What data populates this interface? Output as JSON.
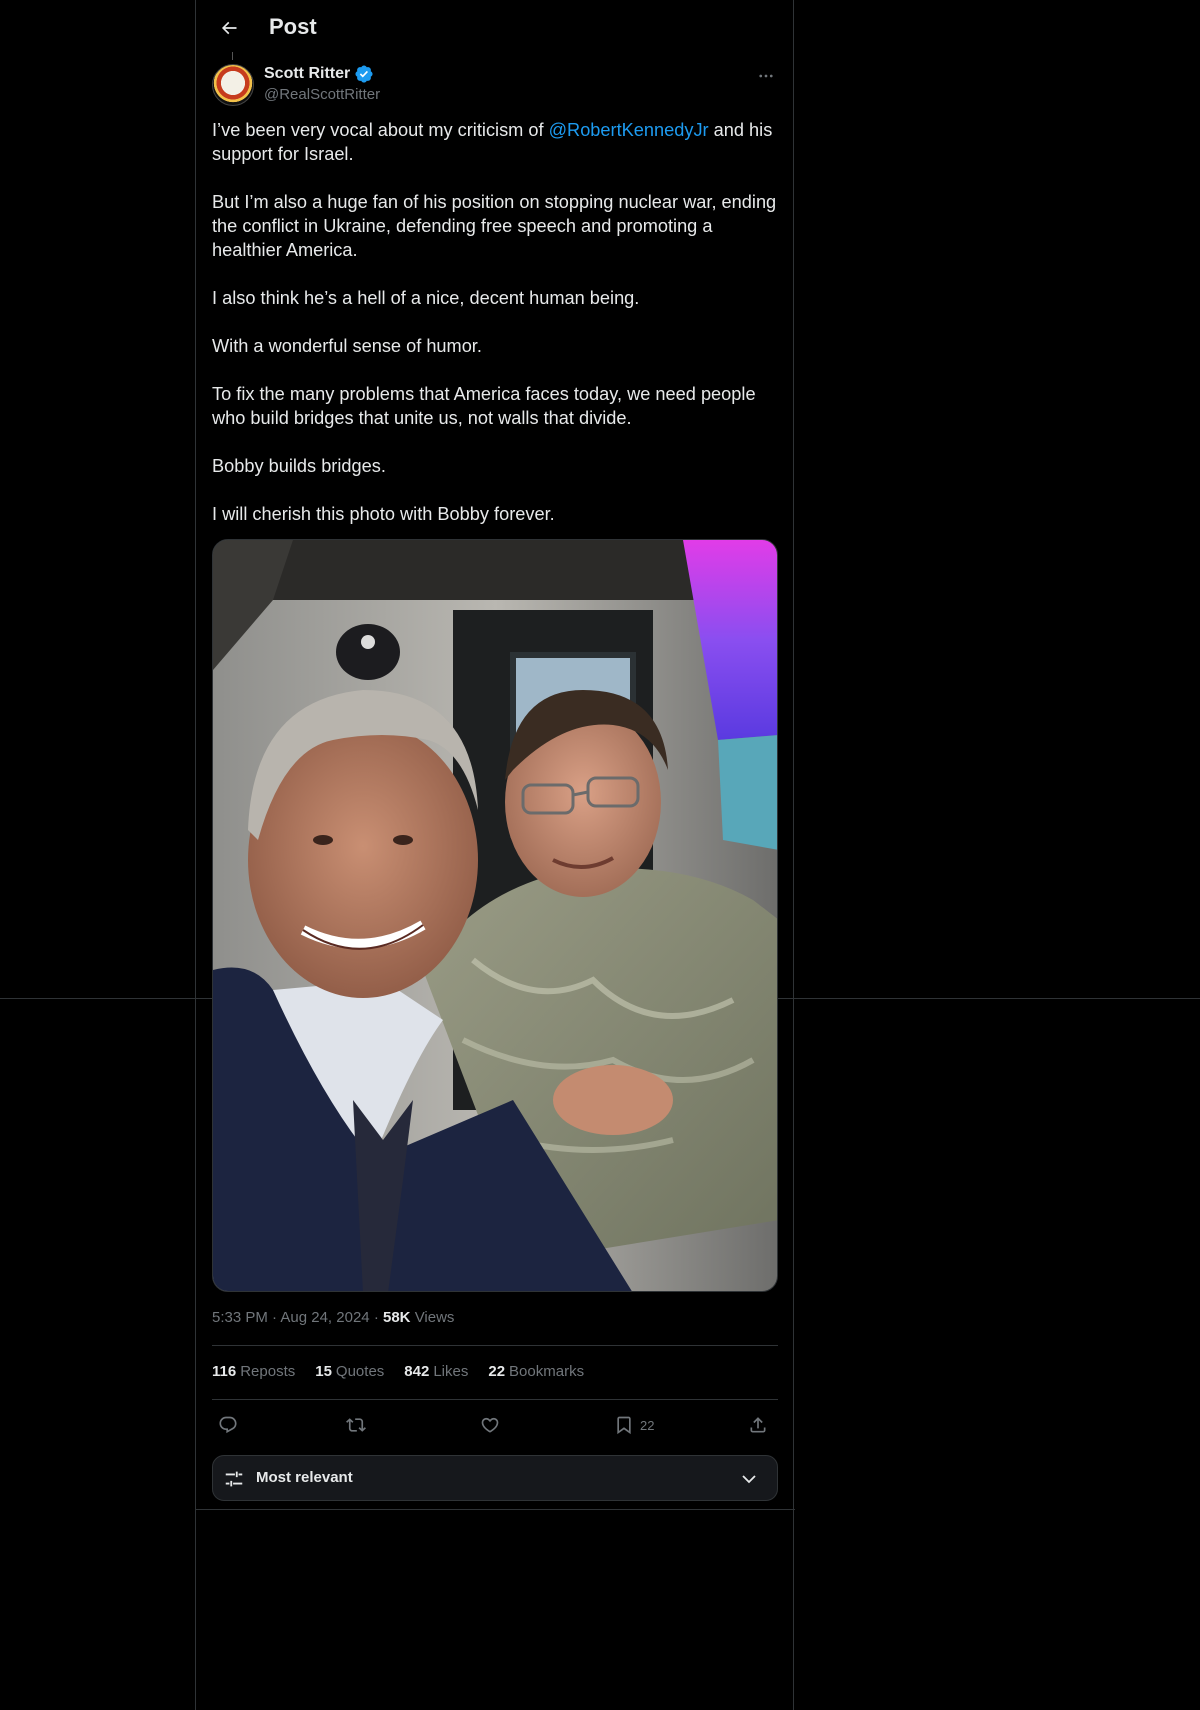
{
  "header": {
    "title": "Post",
    "back_icon": "arrow-left-icon"
  },
  "author": {
    "name": "Scott Ritter",
    "handle": "@RealScottRitter",
    "verified_color": "#1d9bf0"
  },
  "post": {
    "p1_before": "I’ve been very vocal about my criticism of ",
    "p1_mention": "@RobertKennedyJr",
    "p1_after": " and his support for Israel.",
    "p2": "But I’m also a huge fan of his position on stopping nuclear war, ending the conflict in Ukraine, defending free speech and promoting a healthier America.",
    "p3": "I also think he’s a hell of a nice, decent human being.",
    "p4": "With a wonderful sense of humor.",
    "p5": "To fix the many problems that America faces today, we need people who build bridges that unite us, not walls that divide.",
    "p6": "Bobby builds bridges.",
    "p7": "I will cherish this photo with Bobby forever."
  },
  "meta": {
    "time": "5:33 PM",
    "sep1": "·",
    "date": "Aug 24, 2024",
    "sep2": "·",
    "views_count": "58K",
    "views_label": "Views"
  },
  "stats": {
    "reposts_count": "116",
    "reposts_label": "Reposts",
    "quotes_count": "15",
    "quotes_label": "Quotes",
    "likes_count": "842",
    "likes_label": "Likes",
    "bookmarks_count": "22",
    "bookmarks_label": "Bookmarks"
  },
  "actions": {
    "bookmark_count": "22",
    "icons": [
      "reply-icon",
      "repost-icon",
      "like-icon",
      "bookmark-icon",
      "share-icon"
    ]
  },
  "sort": {
    "label": "Most relevant"
  },
  "colors": {
    "background": "#000000",
    "text": "#e7e9ea",
    "muted": "#71767b",
    "accent": "#1d9bf0",
    "border": "#2f3336"
  }
}
